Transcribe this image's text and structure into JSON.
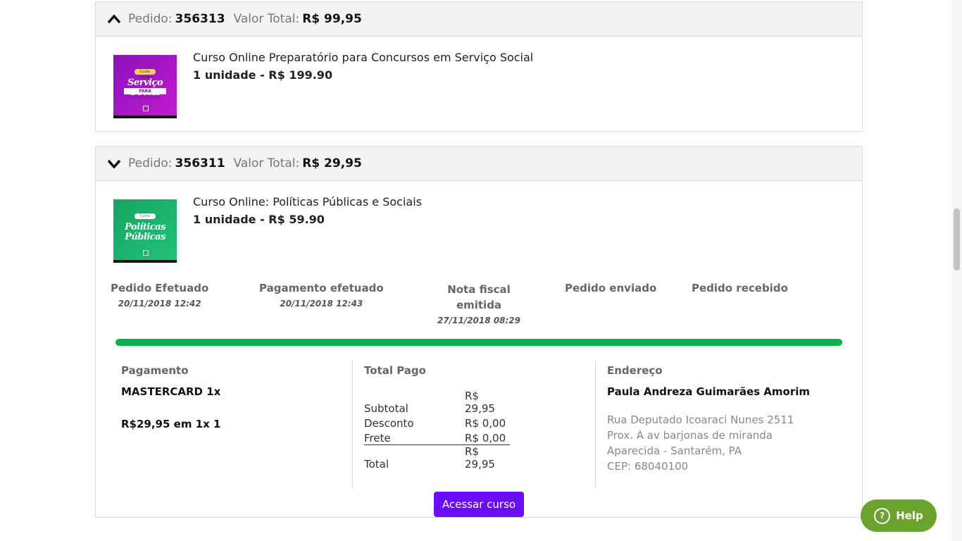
{
  "orders": [
    {
      "expanded": true,
      "order_label": "Pedido:",
      "order_number": "356313",
      "total_label": "Valor Total:",
      "total_value": "R$ 99,95",
      "item": {
        "name": "Curso Online Preparatório para Concursos em Serviço Social",
        "quantity": "1 unidade - R$ 199.90",
        "thumb_badge": "Curso Online",
        "thumb_title": "Serviço Social",
        "thumb_subtitle": "PARA CONCURSOS"
      }
    },
    {
      "expanded": false,
      "order_label": "Pedido:",
      "order_number": "356311",
      "total_label": "Valor Total:",
      "total_value": "R$ 29,95",
      "item": {
        "name": "Curso Online: Políticas Públicas e Sociais",
        "quantity": "1 unidade - R$ 59.90",
        "thumb_badge": "Curso Online",
        "thumb_title": "Políticas Públicas"
      },
      "steps": [
        {
          "label": "Pedido Efetuado",
          "date": "20/11/2018 12:42"
        },
        {
          "label": "Pagamento efetuado",
          "date": "20/11/2018 12:43"
        },
        {
          "label": "Nota fiscal emitida",
          "date": "27/11/2018 08:29"
        },
        {
          "label": "Pedido enviado",
          "date": ""
        },
        {
          "label": "Pedido recebido",
          "date": ""
        }
      ],
      "progress_fraction": 1.0,
      "payment": {
        "title": "Pagamento",
        "method": "MASTERCARD 1x",
        "installments": "R$29,95 em 1x 1"
      },
      "totals": {
        "title": "Total Pago",
        "rows": [
          {
            "label": "Subtotal",
            "value": "R$ 29,95"
          },
          {
            "label": "Desconto",
            "value": "R$ 0,00"
          },
          {
            "label": "Frete",
            "value": "R$ 0,00"
          },
          {
            "label": "Total",
            "value": "R$ 29,95"
          }
        ]
      },
      "address": {
        "title": "Endereço",
        "name": "Paula Andreza Guimarães Amorim",
        "line1": "Rua Deputado Icoaraci Nunes 2511",
        "line2": "Prox. A av barjonas de miranda",
        "line3": "Aparecida - Santarém, PA",
        "line4": "CEP: 68040100"
      },
      "cta_label": "Acessar curso"
    }
  ],
  "help": {
    "label": "Help",
    "icon": "question-circle-icon"
  },
  "colors": {
    "progress": "#0ab04b",
    "cta": "#6a0cf5",
    "help": "#6aa42e"
  }
}
